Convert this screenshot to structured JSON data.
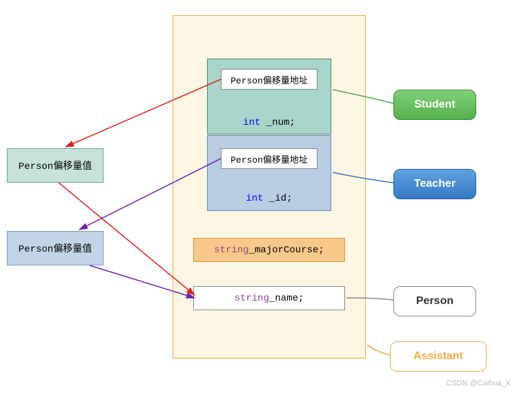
{
  "offset_val_1": "Person偏移量值",
  "offset_val_2": "Person偏移量值",
  "addr_label_1": "Person偏移量地址",
  "addr_label_2": "Person偏移量地址",
  "field_num_kw": "int",
  "field_num_var": " _num;",
  "field_id_kw": "int",
  "field_id_var": " _id;",
  "major_kw": "string",
  "major_var": " _majorCourse;",
  "name_kw": "string",
  "name_var": " _name;",
  "callout_student": "Student",
  "callout_teacher": "Teacher",
  "callout_person": "Person",
  "callout_assistant": "Assistant",
  "watermark": "CSDN @Caihua_X"
}
